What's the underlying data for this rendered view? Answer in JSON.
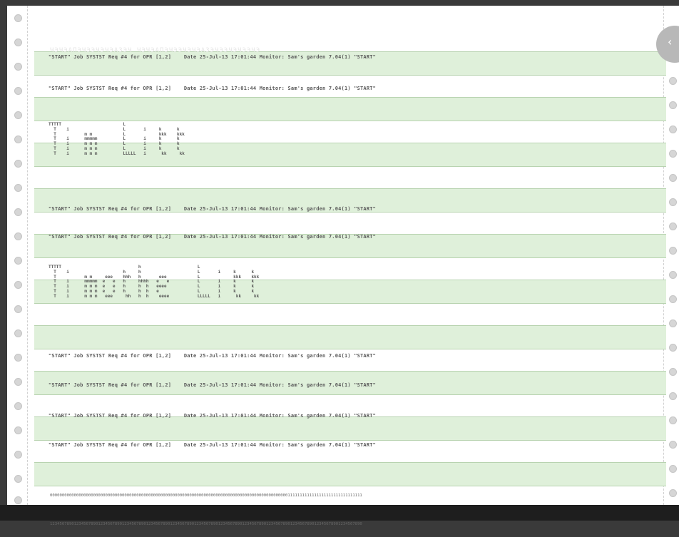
{
  "header_line": "\"START\" Job SYSTST Req #4 for OPR [1,2]    Date 25-Jul-13 17:01:44 Monitor: Sam's garden 7.04(1) \"START\"",
  "ghost_line": "ЧЭЧЭАПЭЧЭЭЧЭЧЭАЗЭЧ  ЧЭЧЭАПЭЧЭЭЧЭЧЭАЗЭЧЭЭЧЭЧЭЭЧЭ",
  "banner_1": "TTTTT                        L\n  T    i                     L       i     k      k\n  T           m m            L             kkk    kkk\n  T    i      mmmmm          L       i     k      k\n  T    i      m m m          L       i     k      k\n  T    i      m m m          L       i     k      k\n  T    i      m m m          LLLLL   i      kk     kk",
  "banner_2": "TTTTT                              h                      L\n  T    i                     h     h                      L       i     k      k\n  T           m m     eee    hhh   h       eee            L             kkk    kkk\n  T    i      mmmmm  e   e   h     hhhh   e   e           L       i     k      k\n  T    i      m m m  e   e   h     h  h   eeee            L       i     k      k\n  T    i      m m m  e   e   h     h  h   e               L       i     k      k\n  T    i      m m m   eee     hh   h  h    eeee           LLLLL   i      kk     kk",
  "ruler": [
    "0000000000000000000000000000000000000000000000000000000000000000000000000000000000000000000000000001111111111111111111111111111111",
    "0000000001111111111222222222233333333334444444444555555555566666666667777777777888888888899999999990000000000111111111122222222223",
    "1234567890123456789012345678901234567890123456789012345678901234567890123456789012345678901234567890123456789012345678901234567890"
  ],
  "corner_icon": "chevron-icon"
}
